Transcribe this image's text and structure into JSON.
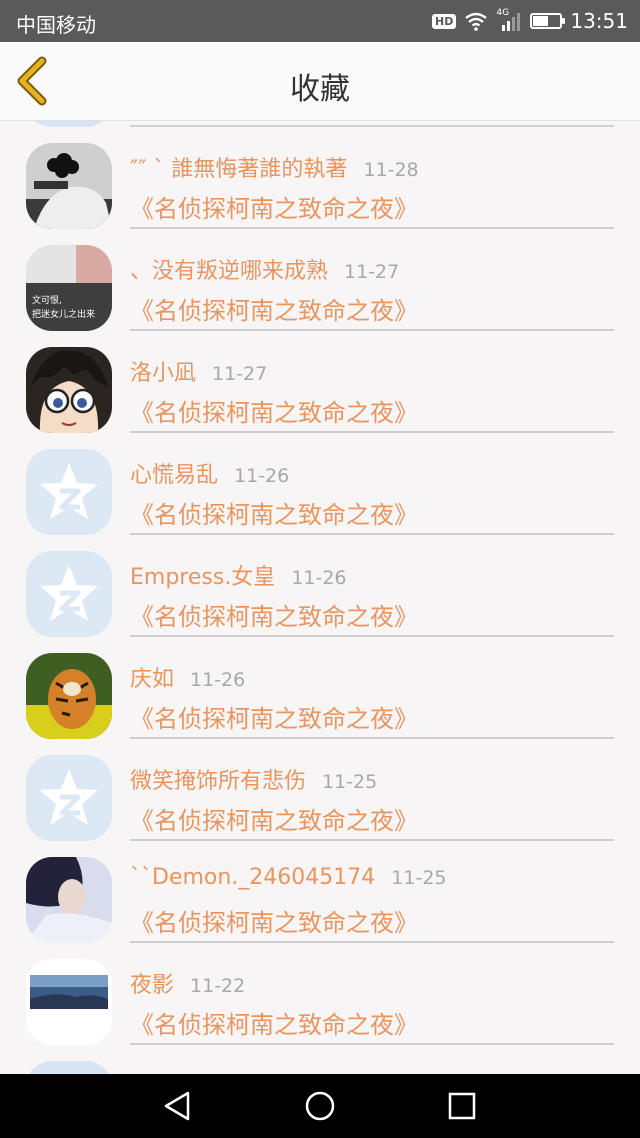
{
  "status_bar": {
    "carrier": "中国移动",
    "hd": "HD",
    "network": "4G",
    "battery_percent": 55,
    "time": "13:51"
  },
  "header": {
    "title": "收藏"
  },
  "items": [
    {
      "name": "″″ ` 誰無悔著誰的執著",
      "date": "11-28",
      "movie": "《名侦探柯南之致命之夜》",
      "avatar": "hand-flower"
    },
    {
      "name": "、没有叛逆哪来成熟",
      "date": "11-27",
      "movie": "《名侦探柯南之致命之夜》",
      "avatar": "girl-text",
      "avatar_text_1": "文可恨,",
      "avatar_text_2": "把迷女儿之出来"
    },
    {
      "name": "洛小凪",
      "date": "11-27",
      "movie": "《名侦探柯南之致命之夜》",
      "avatar": "conan"
    },
    {
      "name": "心慌易乱",
      "date": "11-26",
      "movie": "《名侦探柯南之致命之夜》",
      "avatar": "default-star"
    },
    {
      "name": "Empress.女皇",
      "date": "11-26",
      "movie": "《名侦探柯南之致命之夜》",
      "avatar": "default-star"
    },
    {
      "name": "庆如",
      "date": "11-26",
      "movie": "《名侦探柯南之致命之夜》",
      "avatar": "tiger"
    },
    {
      "name": "微笑掩饰所有悲伤",
      "date": "11-25",
      "movie": "《名侦探柯南之致命之夜》",
      "avatar": "default-star"
    },
    {
      "name": "``Demon._246045174",
      "date": "11-25",
      "movie": "《名侦探柯南之致命之夜》",
      "avatar": "girl-sky"
    },
    {
      "name": "夜影",
      "date": "11-22",
      "movie": "《名侦探柯南之致命之夜》",
      "avatar": "landscape"
    }
  ],
  "colors": {
    "accent": "#e8955f",
    "date": "#a8a8a8",
    "back_arrow": "#d8a21c",
    "statusbar": "#5a5a5a"
  },
  "nav_icons": [
    "back-triangle-icon",
    "home-circle-icon",
    "recents-square-icon"
  ]
}
